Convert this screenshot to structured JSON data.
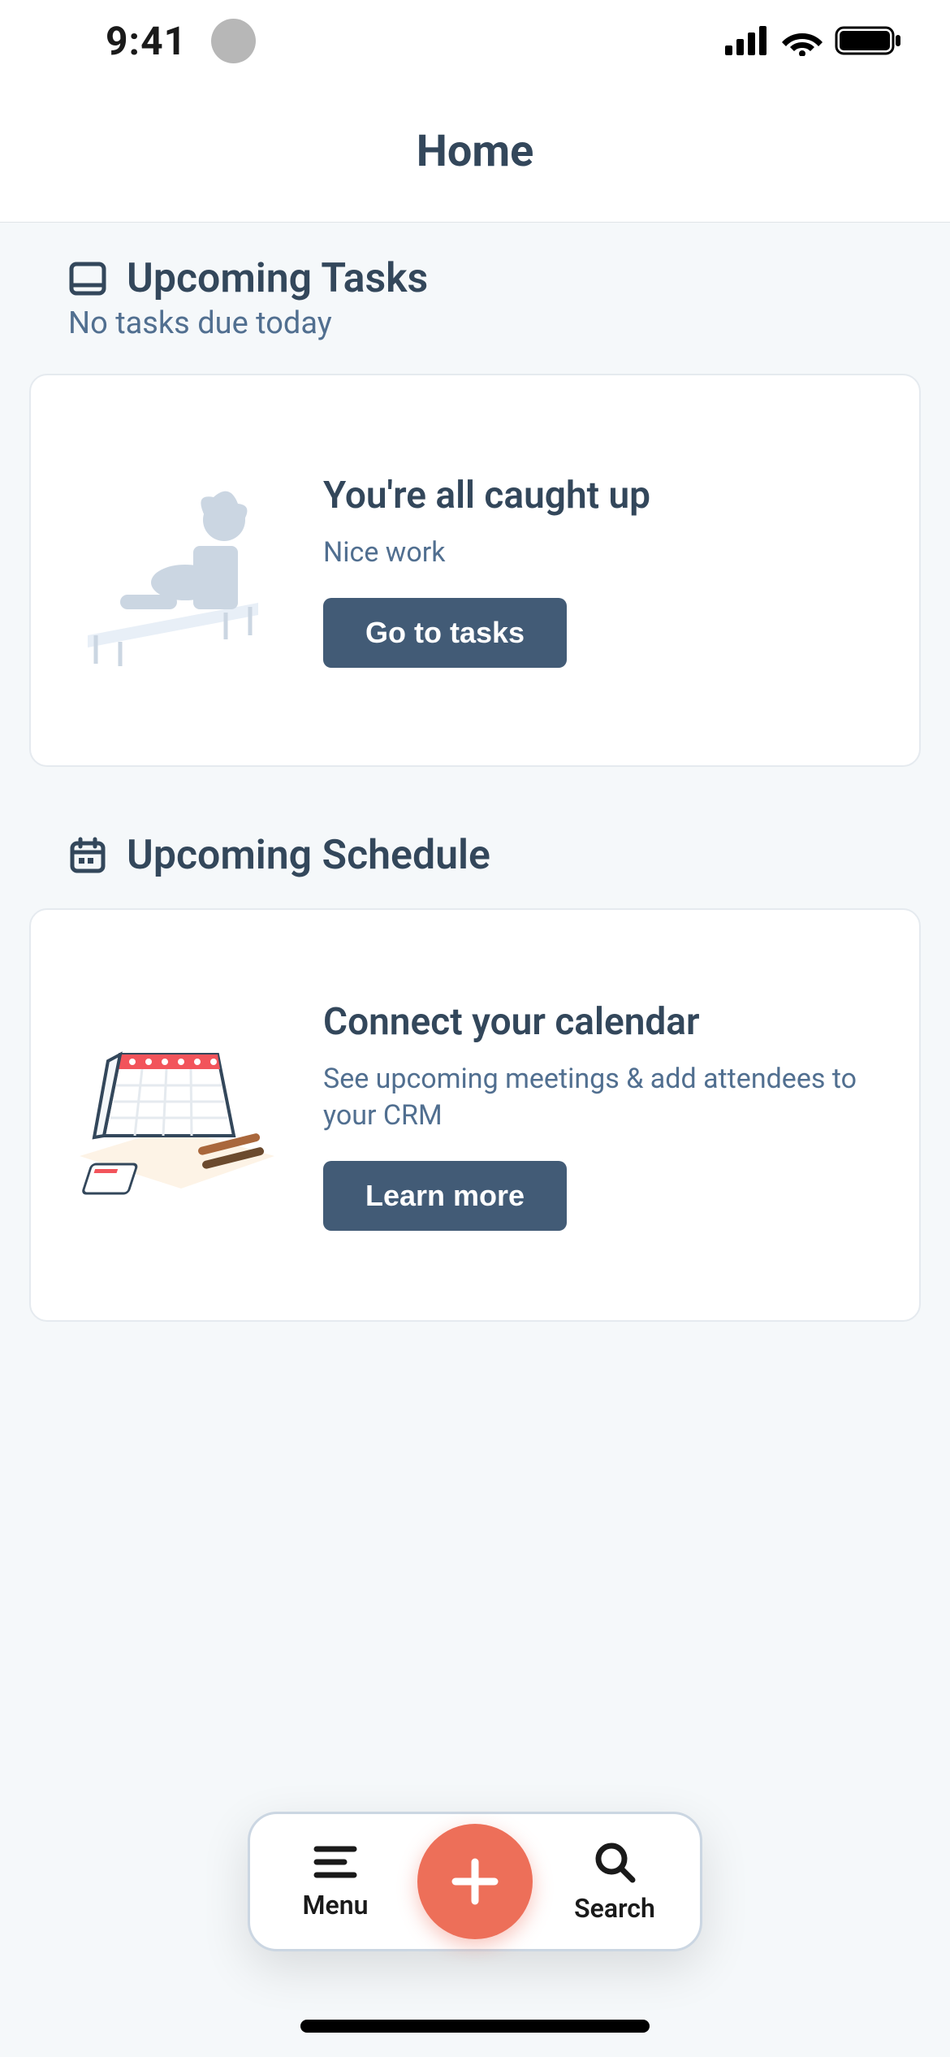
{
  "status": {
    "time": "9:41"
  },
  "header": {
    "title": "Home"
  },
  "tasks": {
    "heading": "Upcoming Tasks",
    "subtitle": "No tasks due today",
    "card": {
      "title": "You're all caught up",
      "desc": "Nice work",
      "button": "Go to tasks"
    }
  },
  "schedule": {
    "heading": "Upcoming Schedule",
    "card": {
      "title": "Connect your calendar",
      "desc": "See upcoming meetings & add attendees to your CRM",
      "button": "Learn more"
    }
  },
  "nav": {
    "menu": "Menu",
    "search": "Search"
  }
}
